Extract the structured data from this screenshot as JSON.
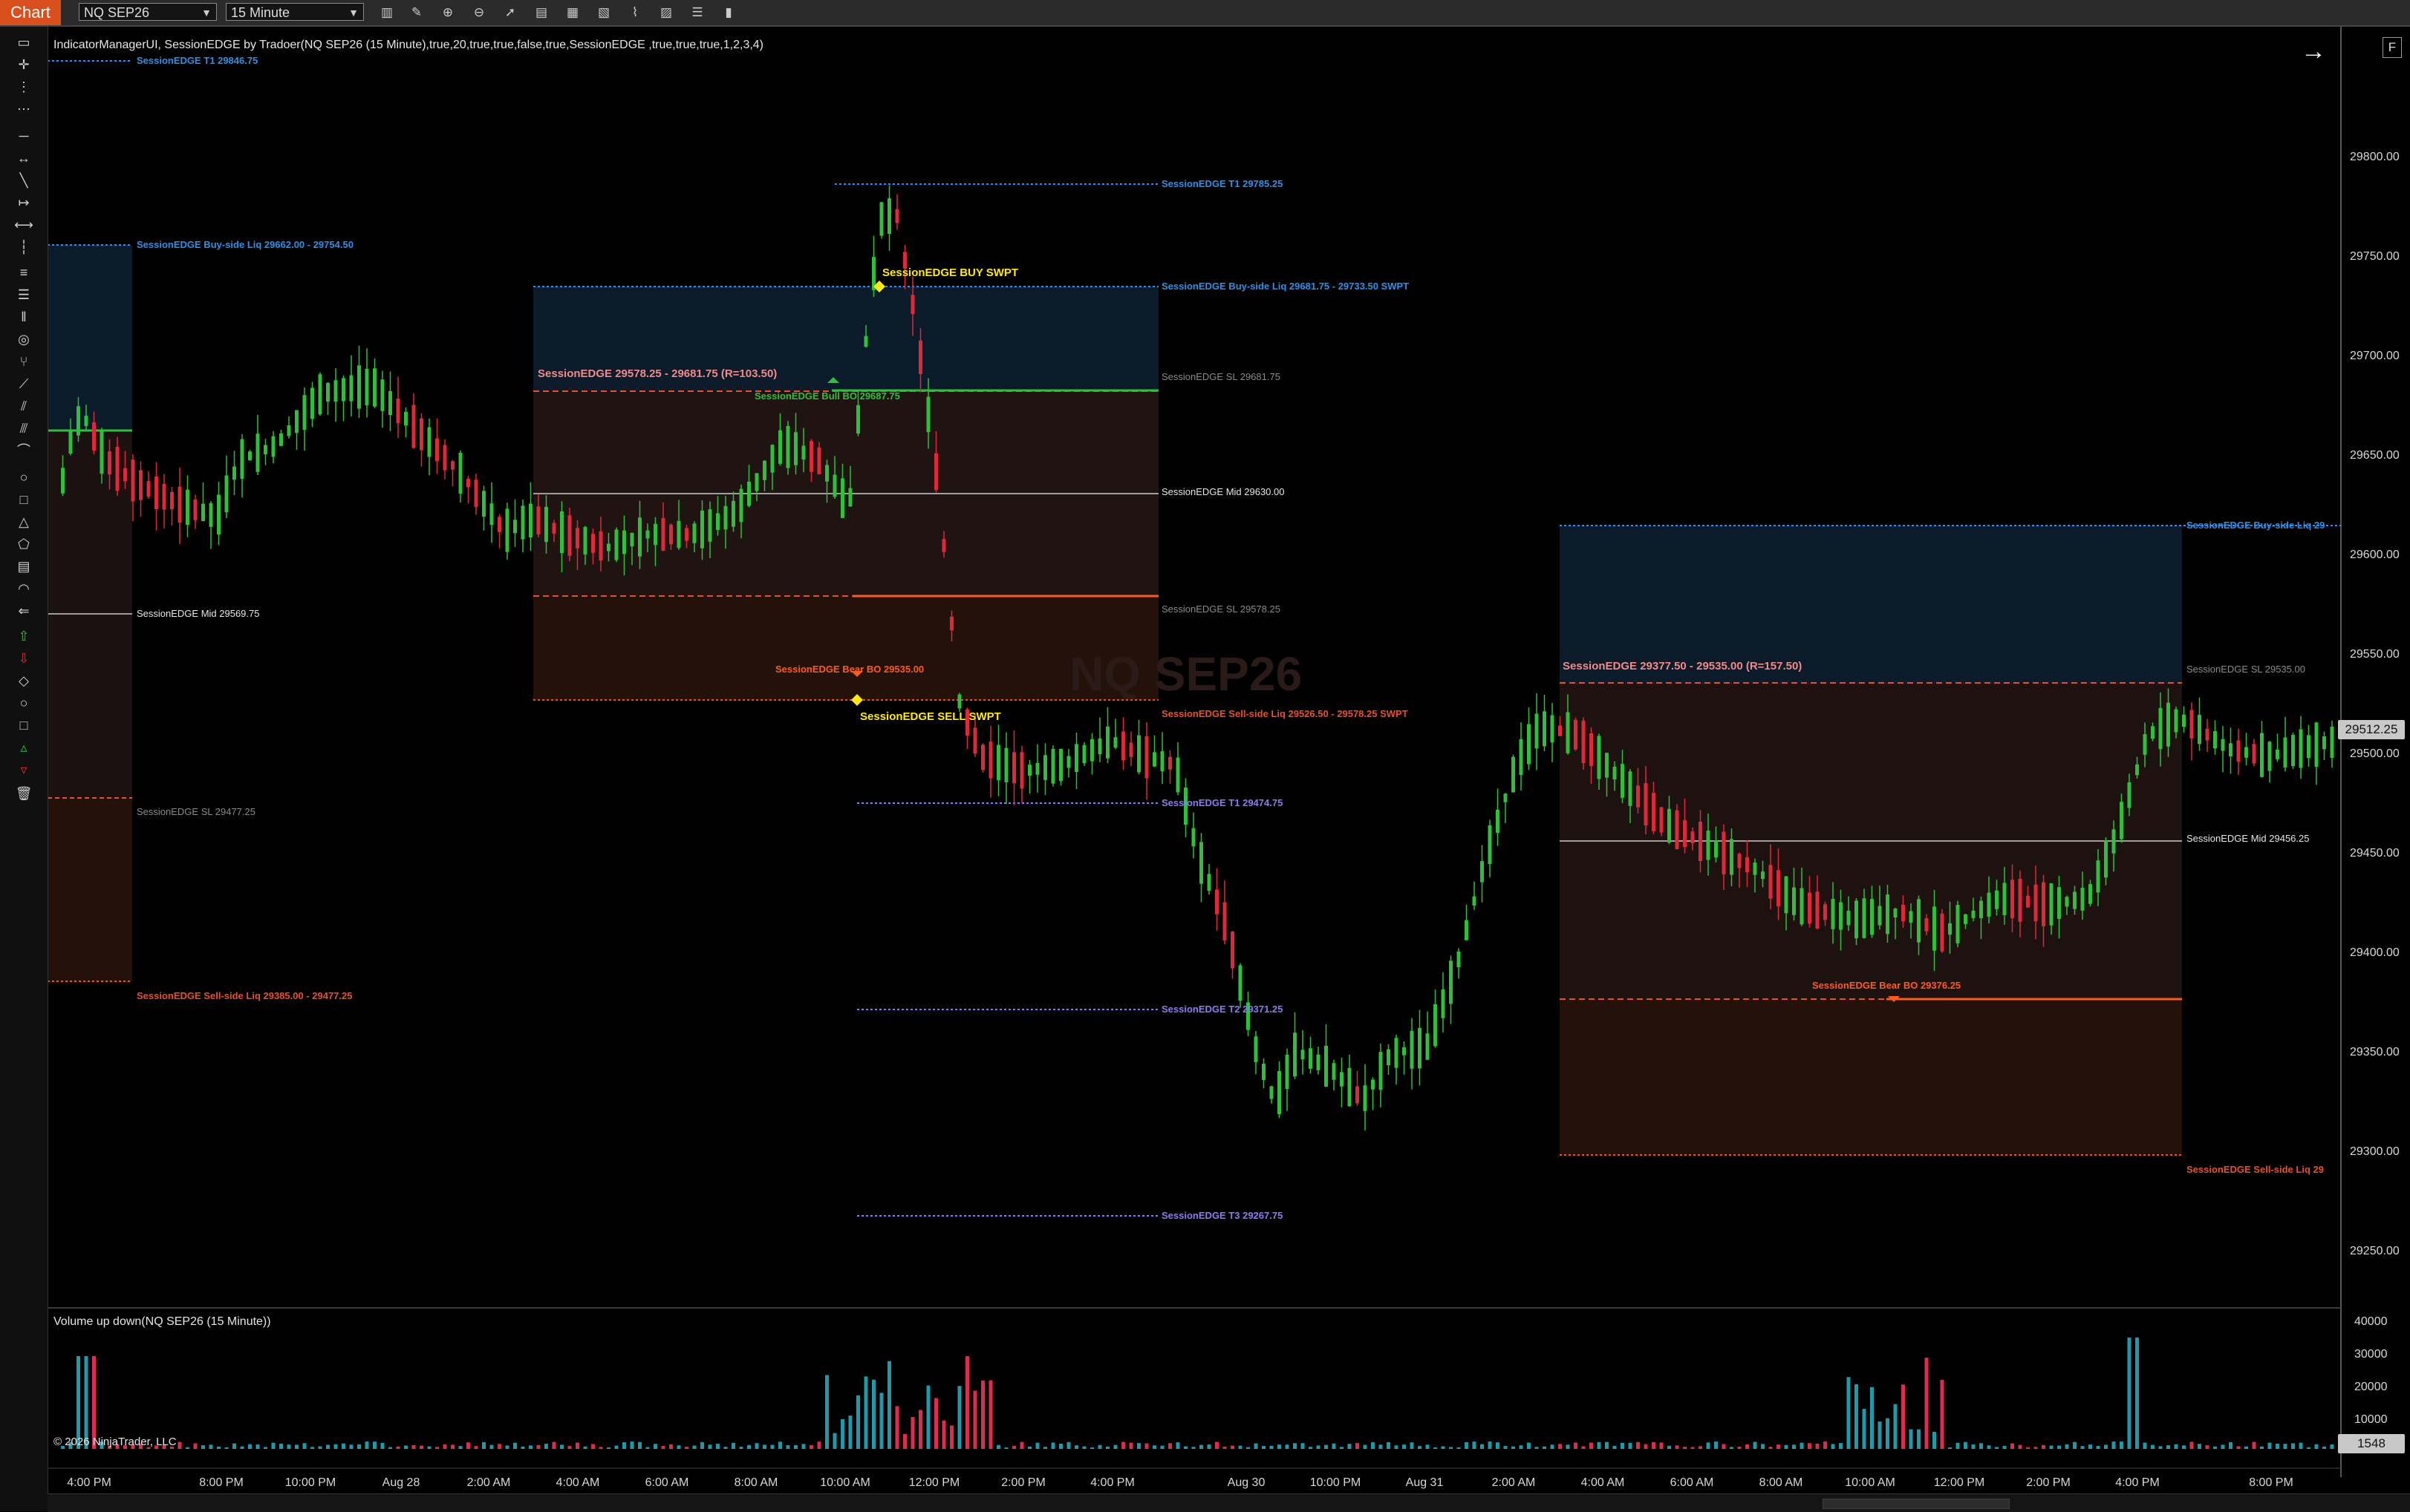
{
  "toolbar": {
    "tab_label": "Chart",
    "instrument": "NQ SEP26",
    "timeframe": "15 Minute",
    "icons": [
      "bars-type-icon",
      "pencil-icon",
      "zoom-in-icon",
      "zoom-out-icon",
      "pointer-icon",
      "properties-icon",
      "data-box-icon",
      "chart-trader-icon",
      "strategies-icon",
      "indicators-icon",
      "templates-icon",
      "hide-icon"
    ]
  },
  "drawing_tools": [
    "ruler-icon",
    "crosshair-icon",
    "global-crosshair-icon",
    "time-marker-icon",
    "line-icon",
    "ray-icon",
    "extended-line-icon",
    "arrow-line-icon",
    "horizontal-line-icon",
    "vertical-line-icon",
    "fib-retrace-icon",
    "fib-extension-icon",
    "fib-time-icon",
    "fib-circle-icon",
    "andrews-pitchfork-icon",
    "gann-fan-icon",
    "regression-channel-icon",
    "trend-channel-icon",
    "risk-reward-icon",
    "ellipse-icon",
    "rectangle-icon",
    "triangle-icon",
    "polygon-icon",
    "region-icon",
    "arc-icon",
    "text-icon",
    "arrow-up-icon",
    "arrow-down-icon",
    "diamond-icon",
    "dot-icon",
    "square-icon",
    "triangle-up-icon",
    "triangle-down-icon",
    "trash-icon"
  ],
  "indicator_label": "IndicatorManagerUI, SessionEDGE by Tradoer(NQ SEP26 (15 Minute),true,20,true,true,false,true,SessionEDGE ,true,true,true,1,2,3,4)",
  "watermark": "NQ SEP26",
  "volume_label": "Volume up down(NQ SEP26 (15 Minute))",
  "copyright": "© 2026 NinjaTrader, LLC",
  "current_price": "29512.25",
  "current_volume": "1548",
  "buttons": {
    "fullscreen": "F",
    "arrow": "→"
  },
  "chart_data": {
    "type": "candlestick",
    "price_axis_ticks": [
      "29800.00",
      "29750.00",
      "29700.00",
      "29650.00",
      "29600.00",
      "29550.00",
      "29500.00",
      "29450.00",
      "29400.00",
      "29350.00",
      "29300.00",
      "29250.00"
    ],
    "volume_axis_ticks": [
      "40000",
      "30000",
      "20000",
      "10000"
    ],
    "time_axis_ticks": [
      "4:00 PM",
      "8:00 PM",
      "10:00 PM",
      "Aug 28",
      "2:00 AM",
      "4:00 AM",
      "6:00 AM",
      "8:00 AM",
      "10:00 AM",
      "12:00 PM",
      "2:00 PM",
      "4:00 PM",
      "Aug 30",
      "10:00 PM",
      "Aug 31",
      "2:00 AM",
      "4:00 AM",
      "6:00 AM",
      "8:00 AM",
      "10:00 AM",
      "12:00 PM",
      "2:00 PM",
      "4:00 PM",
      "8:00 PM"
    ],
    "colors": {
      "up": "#2fbf3a",
      "down": "#e0283a",
      "vol_up": "#1f9aa8",
      "vol_down": "#e02b50",
      "buy_liq": "#2f8fe8",
      "sell_liq": "#e8502a",
      "target": "#8a7cf0",
      "swpt": "#ffe81a",
      "bo_line": "#ff5a1e",
      "range_label": "#f28a8a"
    },
    "annotations": [
      "SessionEDGE T1 29846.75",
      "SessionEDGE Buy-side Liq 29662.00 - 29754.50",
      "SessionEDGE Mid 29569.75",
      "SessionEDGE SL 29477.25",
      "SessionEDGE Sell-side Liq 29385.00 - 29477.25",
      "SessionEDGE T1 29785.25",
      "SessionEDGE Buy-side Liq 29681.75 - 29733.50 SWPT",
      "SessionEDGE SL 29681.75",
      "SessionEDGE Mid 29630.00",
      "SessionEDGE SL 29578.25",
      "SessionEDGE Sell-side Liq 29526.50 - 29578.25 SWPT",
      "SessionEDGE T1 29474.75",
      "SessionEDGE T2 29371.25",
      "SessionEDGE T3 29267.75",
      "SessionEDGE BUY SWPT",
      "SessionEDGE SELL SWPT",
      "SessionEDGE  29578.25 - 29681.75  (R=103.50)",
      "SessionEDGE Bull BO 29687.75",
      "SessionEDGE Bear BO 29535.00",
      "SessionEDGE  29377.50 - 29535.00  (R=157.50)",
      "SessionEDGE Buy-side Liq 29",
      "SessionEDGE SL 29535.00",
      "SessionEDGE Mid 29456.25",
      "SessionEDGE Bear BO 29376.25",
      "SessionEDGE Sell-side Liq 29"
    ]
  }
}
